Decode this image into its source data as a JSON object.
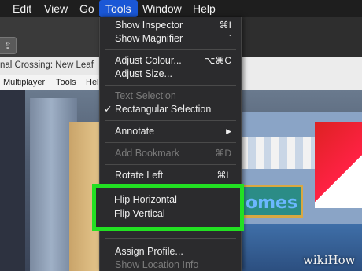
{
  "menubar": {
    "items": [
      "Edit",
      "View",
      "Go",
      "Tools",
      "Window",
      "Help"
    ],
    "active": "Tools"
  },
  "window": {
    "doc_title": "nal Crossing: New Leaf",
    "game_menu": [
      "Multiplayer",
      "Tools",
      "Hel"
    ]
  },
  "scene": {
    "sign_text": "omes"
  },
  "tools_menu": {
    "show_inspector": {
      "label": "Show Inspector",
      "shortcut": "⌘I"
    },
    "show_magnifier": {
      "label": "Show Magnifier",
      "shortcut": "`"
    },
    "adjust_colour": {
      "label": "Adjust Colour...",
      "shortcut": "⌥⌘C"
    },
    "adjust_size": {
      "label": "Adjust Size..."
    },
    "text_selection": {
      "label": "Text Selection",
      "enabled": false
    },
    "rectangular_selection": {
      "label": "Rectangular Selection",
      "checked": true,
      "check": "✓"
    },
    "annotate": {
      "label": "Annotate",
      "submenu_glyph": "▶"
    },
    "add_bookmark": {
      "label": "Add Bookmark",
      "shortcut": "⌘D",
      "enabled": false
    },
    "rotate_left": {
      "label": "Rotate Left",
      "shortcut": "⌘L"
    },
    "flip_horizontal": {
      "label": "Flip Horizontal"
    },
    "flip_vertical": {
      "label": "Flip Vertical"
    },
    "assign_profile": {
      "label": "Assign Profile..."
    },
    "show_location_info": {
      "label": "Show Location Info",
      "enabled": false
    }
  },
  "highlight_color": "#22e022",
  "menu_highlight_color": "#1a57d6",
  "watermark": "wikiHow"
}
